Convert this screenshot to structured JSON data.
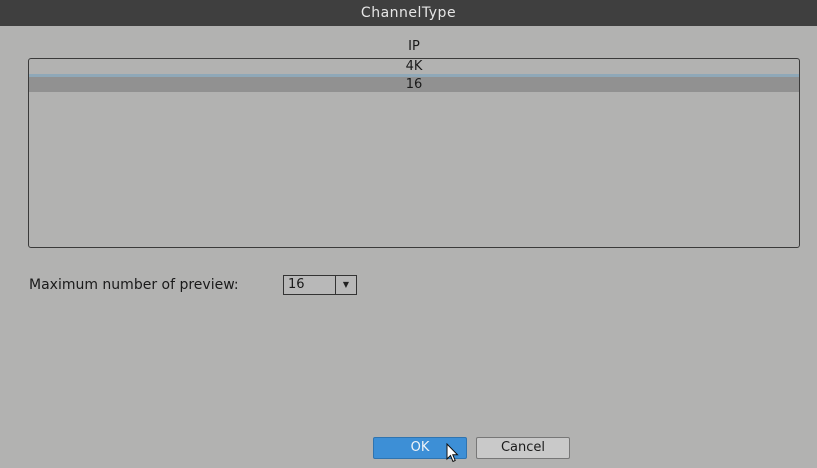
{
  "dialog": {
    "title": "ChannelType"
  },
  "list": {
    "header": "IP",
    "rows": [
      "4K",
      "16"
    ],
    "selected_index": 1
  },
  "preview": {
    "label": "Maximum number of preview:",
    "value": "16"
  },
  "buttons": {
    "ok_label": "OK",
    "cancel_label": "Cancel"
  },
  "icons": {
    "dropdown": "chevron-down-icon",
    "cursor": "mouse-pointer-icon"
  },
  "colors": {
    "titlebar": "#3f3f3f",
    "ok_button": "#3d8fd6",
    "selected_row": "#919191",
    "background": "#b2b2b1"
  }
}
